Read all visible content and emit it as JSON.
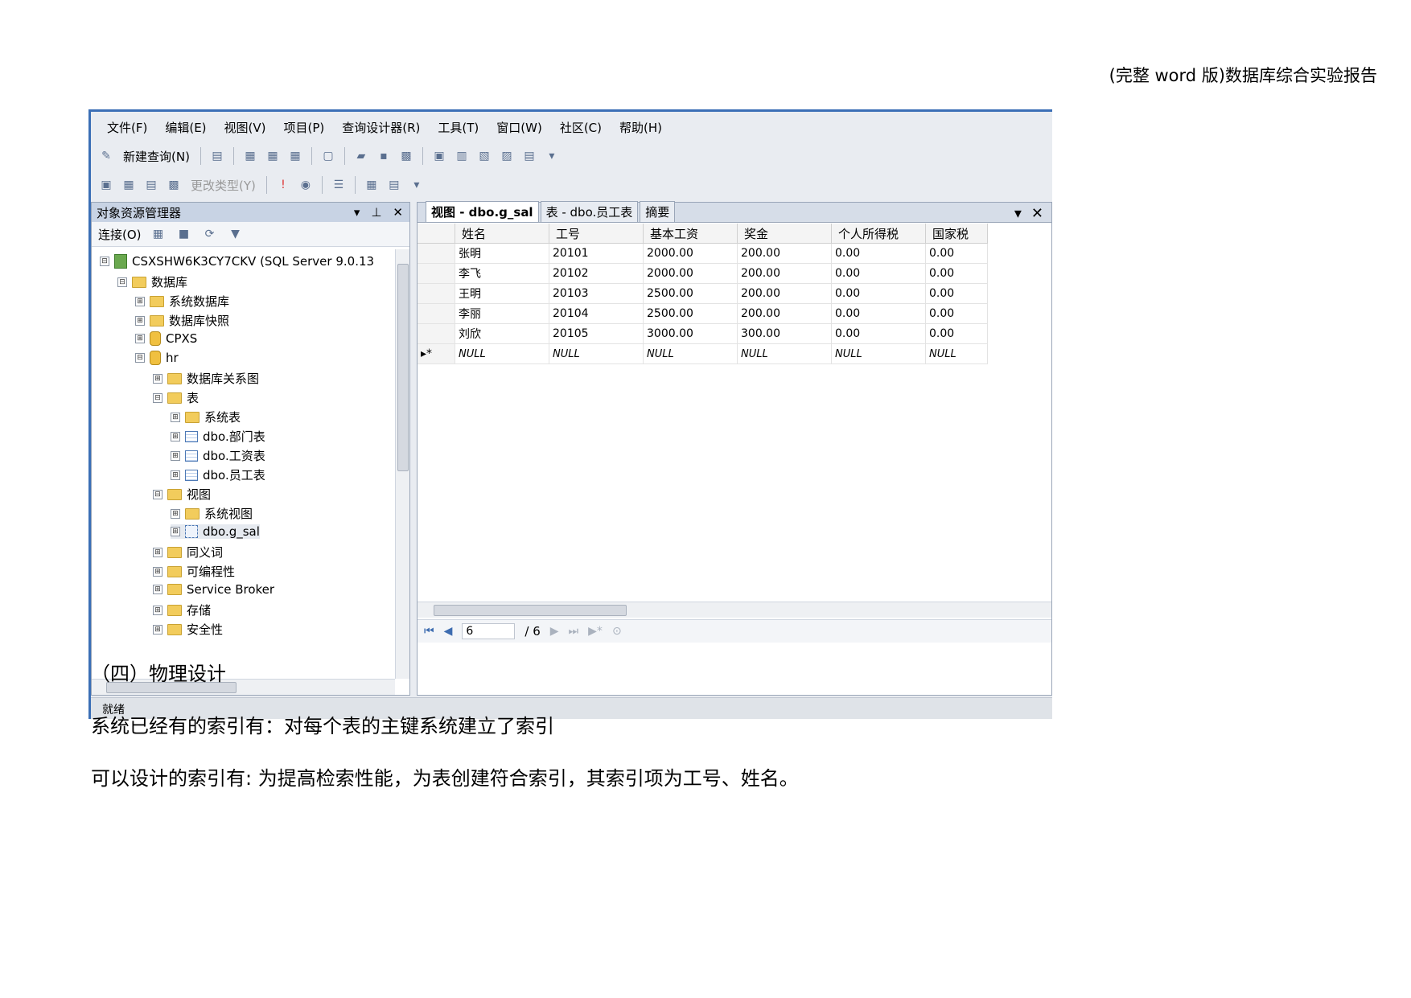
{
  "document": {
    "header": "(完整 word 版)数据库综合实验报告",
    "section_heading": "（四）物理设计",
    "paragraph1": "系统已经有的索引有：对每个表的主键系统建立了索引",
    "paragraph2": "可以设计的索引有: 为提高检索性能，为表创建符合索引，其索引项为工号、姓名。"
  },
  "app": {
    "menu": [
      "文件(F)",
      "编辑(E)",
      "视图(V)",
      "项目(P)",
      "查询设计器(R)",
      "工具(T)",
      "窗口(W)",
      "社区(C)",
      "帮助(H)"
    ],
    "toolbar": {
      "new_query": "新建查询(N)",
      "change_type": "更改类型(Y)"
    },
    "object_explorer": {
      "title": "对象资源管理器",
      "connect": "连接(O)",
      "tree": [
        {
          "label": "CSXSHW6K3CY7CKV (SQL Server 9.0.13",
          "icon": "server-icon",
          "toggle": "⊟"
        },
        {
          "label": "数据库",
          "icon": "folder-icon",
          "toggle": "⊟"
        },
        {
          "label": "系统数据库",
          "icon": "folder-icon",
          "toggle": "⊞"
        },
        {
          "label": "数据库快照",
          "icon": "folder-icon",
          "toggle": "⊞"
        },
        {
          "label": "CPXS",
          "icon": "database-icon",
          "toggle": "⊞"
        },
        {
          "label": "hr",
          "icon": "database-icon",
          "toggle": "⊟"
        },
        {
          "label": "数据库关系图",
          "icon": "folder-icon",
          "toggle": "⊞"
        },
        {
          "label": "表",
          "icon": "folder-icon",
          "toggle": "⊟"
        },
        {
          "label": "系统表",
          "icon": "folder-icon",
          "toggle": "⊞"
        },
        {
          "label": "dbo.部门表",
          "icon": "table-icon",
          "toggle": "⊞"
        },
        {
          "label": "dbo.工资表",
          "icon": "table-icon",
          "toggle": "⊞"
        },
        {
          "label": "dbo.员工表",
          "icon": "table-icon",
          "toggle": "⊞"
        },
        {
          "label": "视图",
          "icon": "folder-icon",
          "toggle": "⊟"
        },
        {
          "label": "系统视图",
          "icon": "folder-icon",
          "toggle": "⊞"
        },
        {
          "label": "dbo.g_sal",
          "icon": "view-icon",
          "toggle": "⊞"
        },
        {
          "label": "同义词",
          "icon": "folder-icon",
          "toggle": "⊞"
        },
        {
          "label": "可编程性",
          "icon": "folder-icon",
          "toggle": "⊞"
        },
        {
          "label": "Service Broker",
          "icon": "folder-icon",
          "toggle": "⊞"
        },
        {
          "label": "存储",
          "icon": "folder-icon",
          "toggle": "⊞"
        },
        {
          "label": "安全性",
          "icon": "folder-icon",
          "toggle": "⊞"
        }
      ]
    },
    "tabs": [
      "视图 - dbo.g_sal",
      "表 - dbo.员工表",
      "摘要"
    ],
    "grid": {
      "columns": [
        "姓名",
        "工号",
        "基本工资",
        "奖金",
        "个人所得税",
        "国家税"
      ],
      "rows": [
        [
          "张明",
          "20101",
          "2000.00",
          "200.00",
          "0.00",
          "0.00"
        ],
        [
          "李飞",
          "20102",
          "2000.00",
          "200.00",
          "0.00",
          "0.00"
        ],
        [
          "王明",
          "20103",
          "2500.00",
          "200.00",
          "0.00",
          "0.00"
        ],
        [
          "李丽",
          "20104",
          "2500.00",
          "200.00",
          "0.00",
          "0.00"
        ],
        [
          "刘欣",
          "20105",
          "3000.00",
          "300.00",
          "0.00",
          "0.00"
        ],
        [
          "NULL",
          "NULL",
          "NULL",
          "NULL",
          "NULL",
          "NULL"
        ]
      ],
      "new_row_marker": "▸*"
    },
    "navigator": {
      "current": "6",
      "total": "/ 6"
    },
    "status": "就绪"
  }
}
